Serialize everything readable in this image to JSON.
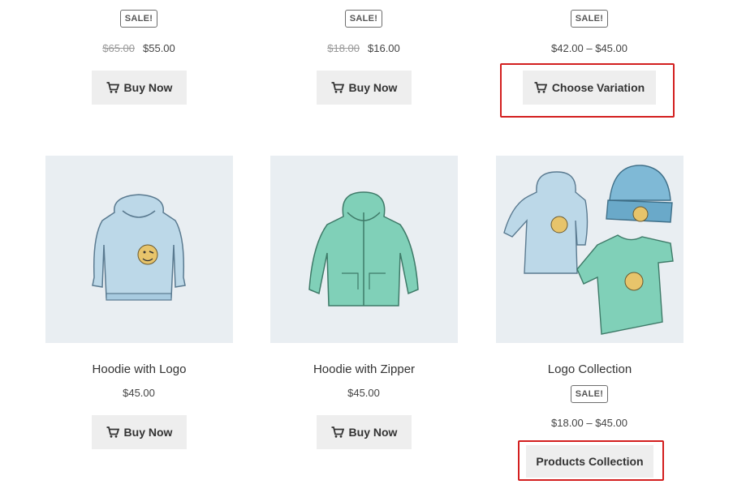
{
  "products_top": [
    {
      "badge": "SALE!",
      "old_price": "$65.00",
      "price": "$55.00",
      "button": "Buy Now"
    },
    {
      "badge": "SALE!",
      "old_price": "$18.00",
      "price": "$16.00",
      "button": "Buy Now"
    },
    {
      "badge": "SALE!",
      "price_range": "$42.00 – $45.00",
      "button": "Choose Variation"
    }
  ],
  "products_bottom": [
    {
      "title": "Hoodie with Logo",
      "price": "$45.00",
      "button": "Buy Now",
      "image": "hoodie-with-logo"
    },
    {
      "title": "Hoodie with Zipper",
      "price": "$45.00",
      "button": "Buy Now",
      "image": "hoodie-with-zipper"
    },
    {
      "title": "Logo Collection",
      "badge": "SALE!",
      "price_range": "$18.00 – $45.00",
      "button": "Products Collection",
      "image": "logo-collection"
    }
  ],
  "icons": {
    "cart": "cart-icon"
  },
  "colors": {
    "highlight": "#d31f1f",
    "button_bg": "#eeeeee",
    "image_bg": "#e9eef2",
    "hoodie_blue": "#b9d6e6",
    "hoodie_green": "#7fcfb7"
  }
}
